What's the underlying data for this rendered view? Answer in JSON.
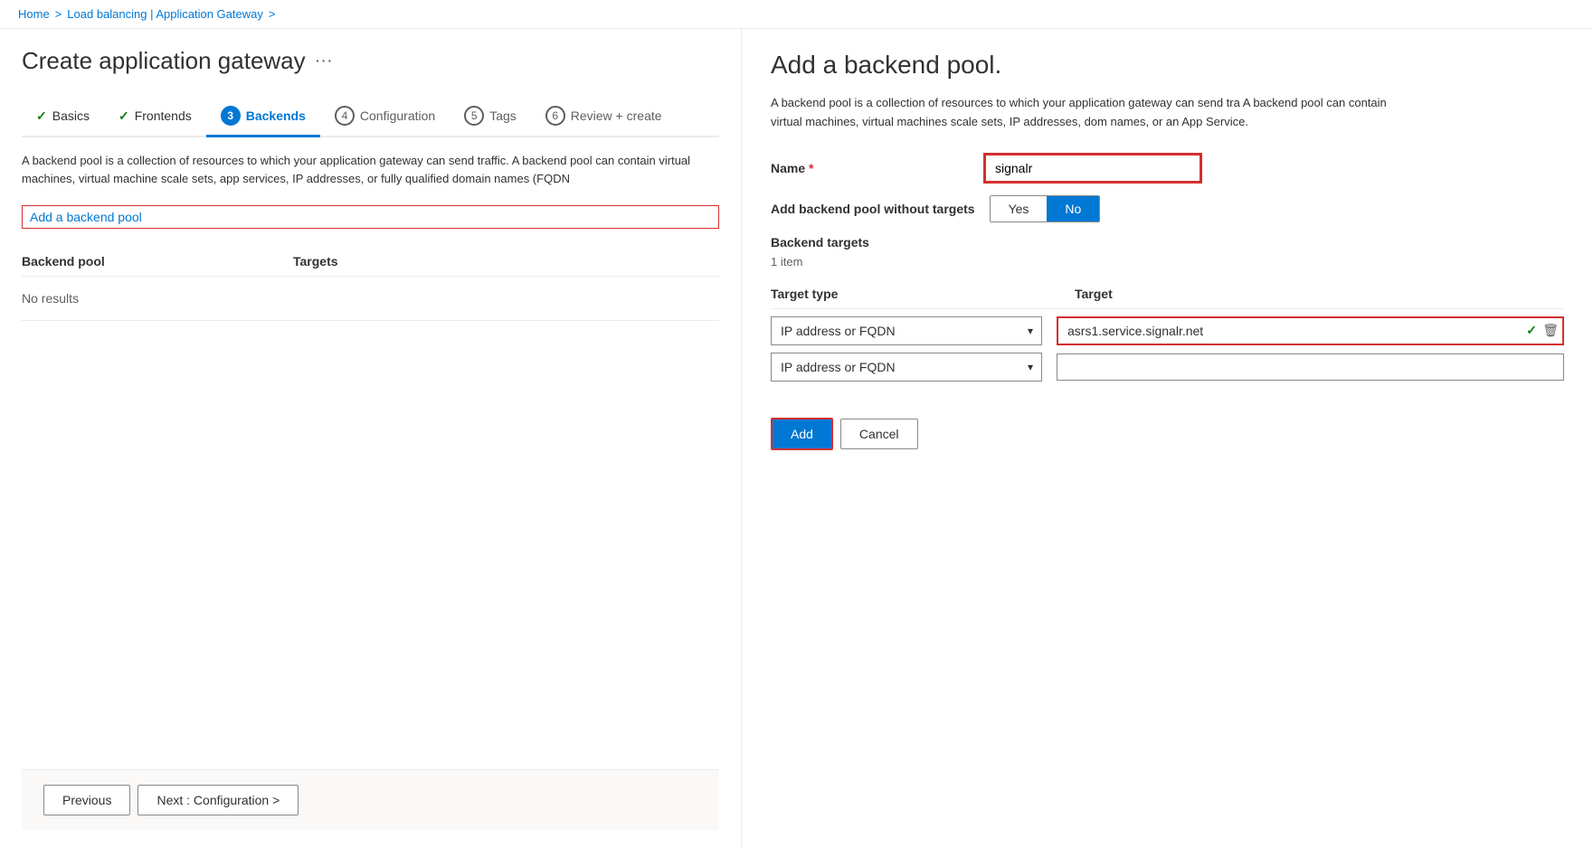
{
  "breadcrumb": {
    "home": "Home",
    "separator1": ">",
    "loadBalancing": "Load balancing | Application Gateway",
    "separator2": ">",
    "current": ""
  },
  "pageTitle": "Create application gateway",
  "ellipsis": "···",
  "steps": [
    {
      "id": "basics",
      "label": "Basics",
      "state": "completed",
      "num": ""
    },
    {
      "id": "frontends",
      "label": "Frontends",
      "state": "completed",
      "num": ""
    },
    {
      "id": "backends",
      "label": "Backends",
      "state": "active",
      "num": "3"
    },
    {
      "id": "configuration",
      "label": "Configuration",
      "state": "default",
      "num": "4"
    },
    {
      "id": "tags",
      "label": "Tags",
      "state": "default",
      "num": "5"
    },
    {
      "id": "review",
      "label": "Review + create",
      "state": "default",
      "num": "6"
    }
  ],
  "mainDescription": "A backend pool is a collection of resources to which your application gateway can send traffic. A backend pool can contain virtual machines, virtual machine scale sets, app services, IP addresses, or fully qualified domain names (FQDN",
  "addBackendLink": "Add a backend pool",
  "tableHeaders": {
    "pool": "Backend pool",
    "targets": "Targets"
  },
  "noResults": "No results",
  "bottomBar": {
    "previous": "Previous",
    "next": "Next : Configuration >"
  },
  "rightPanel": {
    "title": "Add a backend pool.",
    "description": "A backend pool is a collection of resources to which your application gateway can send tra A backend pool can contain virtual machines, virtual machines scale sets, IP addresses, dom names, or an App Service.",
    "nameLabel": "Name",
    "nameRequired": true,
    "nameValue": "signalr",
    "addWithoutTargetsLabel": "Add backend pool without targets",
    "yesLabel": "Yes",
    "noLabel": "No",
    "activeToggle": "No",
    "backendTargetsLabel": "Backend targets",
    "itemCount": "1 item",
    "targetsHeader": {
      "type": "Target type",
      "target": "Target"
    },
    "targetRows": [
      {
        "type": "IP address or FQDN",
        "target": "asrs1.service.signalr.net",
        "hasRedBorder": true,
        "hasCheck": true
      },
      {
        "type": "IP address or FQDN",
        "target": "",
        "hasRedBorder": false,
        "hasCheck": false
      }
    ],
    "addButton": "Add",
    "cancelButton": "Cancel"
  }
}
